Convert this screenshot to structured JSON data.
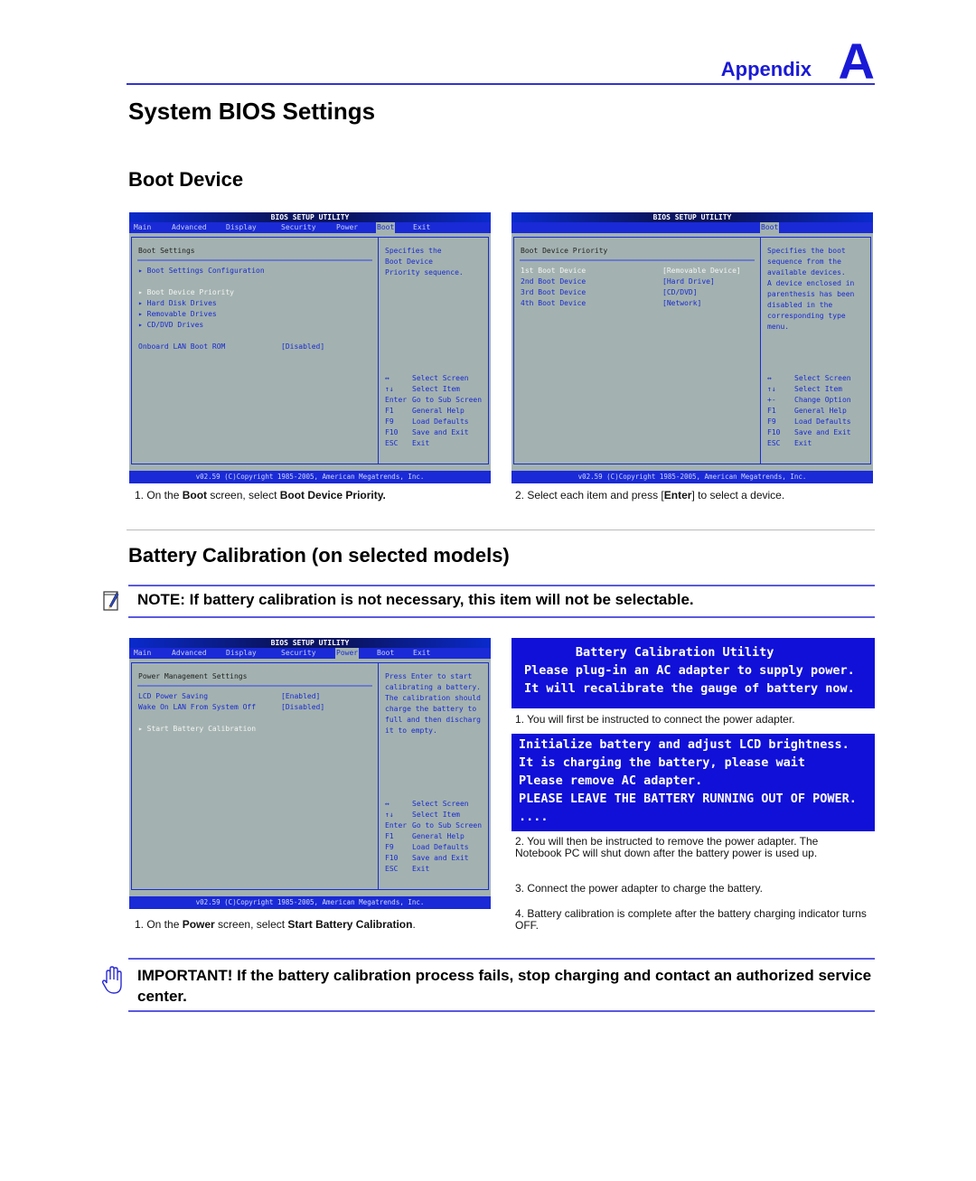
{
  "header": {
    "appendix_label": "Appendix",
    "appendix_letter": "A"
  },
  "page_title": "System BIOS Settings",
  "sections": {
    "boot_device": "Boot Device",
    "battery": "Battery Calibration (on selected models)"
  },
  "bios_common": {
    "title": "BIOS SETUP UTILITY",
    "tabs": [
      "Main",
      "Advanced",
      "Display",
      "Security",
      "Power",
      "Boot",
      "Exit"
    ],
    "footer": "v02.59 (C)Copyright 1985-2005, American Megatrends, Inc."
  },
  "bios_boot": {
    "active_tab": "Boot",
    "heading": "Boot Settings",
    "items": [
      "▸ Boot Settings Configuration",
      "▸ Boot Device Priority",
      "▸ Hard Disk Drives",
      "▸ Removable Drives",
      "▸ CD/DVD Drives",
      "Onboard LAN Boot ROM"
    ],
    "lan_value": "[Disabled]",
    "help": [
      "Specifies the",
      "Boot Device",
      "Priority sequence."
    ],
    "keys": [
      {
        "key": "↔",
        "desc": "Select Screen"
      },
      {
        "key": "↑↓",
        "desc": "Select Item"
      },
      {
        "key": "Enter",
        "desc": "Go to Sub Screen"
      },
      {
        "key": "F1",
        "desc": "General Help"
      },
      {
        "key": "F9",
        "desc": "Load Defaults"
      },
      {
        "key": "F10",
        "desc": "Save and Exit"
      },
      {
        "key": "ESC",
        "desc": "Exit"
      }
    ]
  },
  "bios_priority": {
    "active_tab": "Boot",
    "heading": "Boot Device Priority",
    "items": [
      {
        "label": "1st Boot Device",
        "value": "[Removable Device]"
      },
      {
        "label": "2nd Boot Device",
        "value": "[Hard Drive]"
      },
      {
        "label": "3rd Boot Device",
        "value": "[CD/DVD]"
      },
      {
        "label": "4th Boot Device",
        "value": "[Network]"
      }
    ],
    "help": [
      "Specifies the boot",
      "sequence from the",
      "available devices.",
      "",
      "A device enclosed in",
      "parenthesis has been",
      "disabled in the",
      "corresponding type",
      "menu."
    ],
    "keys": [
      {
        "key": "↔",
        "desc": "Select Screen"
      },
      {
        "key": "↑↓",
        "desc": "Select Item"
      },
      {
        "key": "+-",
        "desc": "Change Option"
      },
      {
        "key": "F1",
        "desc": "General Help"
      },
      {
        "key": "F9",
        "desc": "Load Defaults"
      },
      {
        "key": "F10",
        "desc": "Save and Exit"
      },
      {
        "key": "ESC",
        "desc": "Exit"
      }
    ]
  },
  "bios_power": {
    "active_tab": "Power",
    "heading": "Power Management Settings",
    "items": [
      {
        "label": "LCD Power Saving",
        "value": "[Enabled]"
      },
      {
        "label": "Wake On LAN From System Off",
        "value": "[Disabled]"
      }
    ],
    "start_item": "▸ Start Battery Calibration",
    "help": [
      "Press Enter to start",
      "calibrating a battery.",
      "The calibration should",
      "charge the battery to",
      "full and then discharg",
      "it to empty."
    ],
    "keys": [
      {
        "key": "↔",
        "desc": "Select Screen"
      },
      {
        "key": "↑↓",
        "desc": "Select Item"
      },
      {
        "key": "Enter",
        "desc": "Go to Sub Screen"
      },
      {
        "key": "F1",
        "desc": "General Help"
      },
      {
        "key": "F9",
        "desc": "Load Defaults"
      },
      {
        "key": "F10",
        "desc": "Save and Exit"
      },
      {
        "key": "ESC",
        "desc": "Exit"
      }
    ]
  },
  "captions": {
    "boot1": {
      "pre": "1. On the ",
      "b1": "Boot",
      "mid": " screen, select ",
      "b2": "Boot Device Priority."
    },
    "boot2": {
      "pre": "2. Select each item and press [",
      "b1": "Enter",
      "post": "] to select a device."
    },
    "power1": {
      "pre": "1. On the ",
      "b1": "Power",
      "mid": " screen, select ",
      "b2": "Start Battery Calibration",
      "post": "."
    },
    "cal1": "1. You will first be instructed to connect the power adapter.",
    "cal2": "2. You will then be instructed to remove the power adapter. The Notebook PC will shut down after the battery power is used up.",
    "cal3": "3. Connect the power adapter to charge the battery.",
    "cal4": "4. Battery calibration is complete after the battery charging indicator turns OFF."
  },
  "calibration_screen1": [
    "       Battery Calibration Utility",
    "Please plug-in an AC adapter to supply power.",
    "It will recalibrate the gauge of battery now."
  ],
  "calibration_screen2": [
    "Initialize battery and adjust LCD brightness.",
    "It is charging the battery, please wait",
    "Please remove AC adapter.",
    "PLEASE LEAVE THE BATTERY RUNNING OUT OF POWER.",
    "...."
  ],
  "note": "NOTE: If battery calibration is not necessary, this item will not be selectable.",
  "important": "IMPORTANT!  If the battery calibration process fails, stop charging and contact an authorized service center.",
  "colors": {
    "accent": "#1a1ad6",
    "bios_blue": "#1a2ad6",
    "bios_gray": "#a3b2b0"
  }
}
